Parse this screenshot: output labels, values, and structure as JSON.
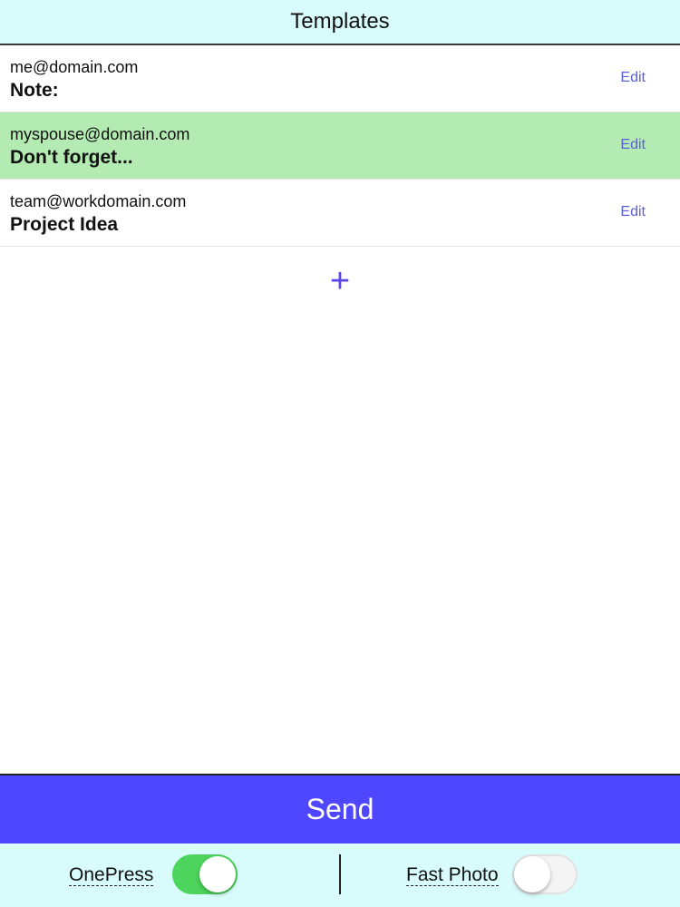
{
  "header": {
    "title": "Templates"
  },
  "templates": [
    {
      "email": "me@domain.com",
      "subject": "Note:",
      "edit_label": "Edit",
      "selected": false
    },
    {
      "email": "myspouse@domain.com",
      "subject": "Don't forget...",
      "edit_label": "Edit",
      "selected": true
    },
    {
      "email": "team@workdomain.com",
      "subject": "Project Idea",
      "edit_label": "Edit",
      "selected": false
    }
  ],
  "add_button": {
    "icon": "plus-icon",
    "glyph": "+"
  },
  "send": {
    "label": "Send"
  },
  "footer": {
    "onepress": {
      "label": "OnePress",
      "on": true
    },
    "fast_photo": {
      "label": "Fast Photo",
      "on": false
    }
  },
  "colors": {
    "header_bg": "#d8fbfb",
    "selected_row": "#b3ebb2",
    "accent": "#4f47ff",
    "edit_link": "#5b5fd9",
    "toggle_on": "#4cd45c"
  }
}
